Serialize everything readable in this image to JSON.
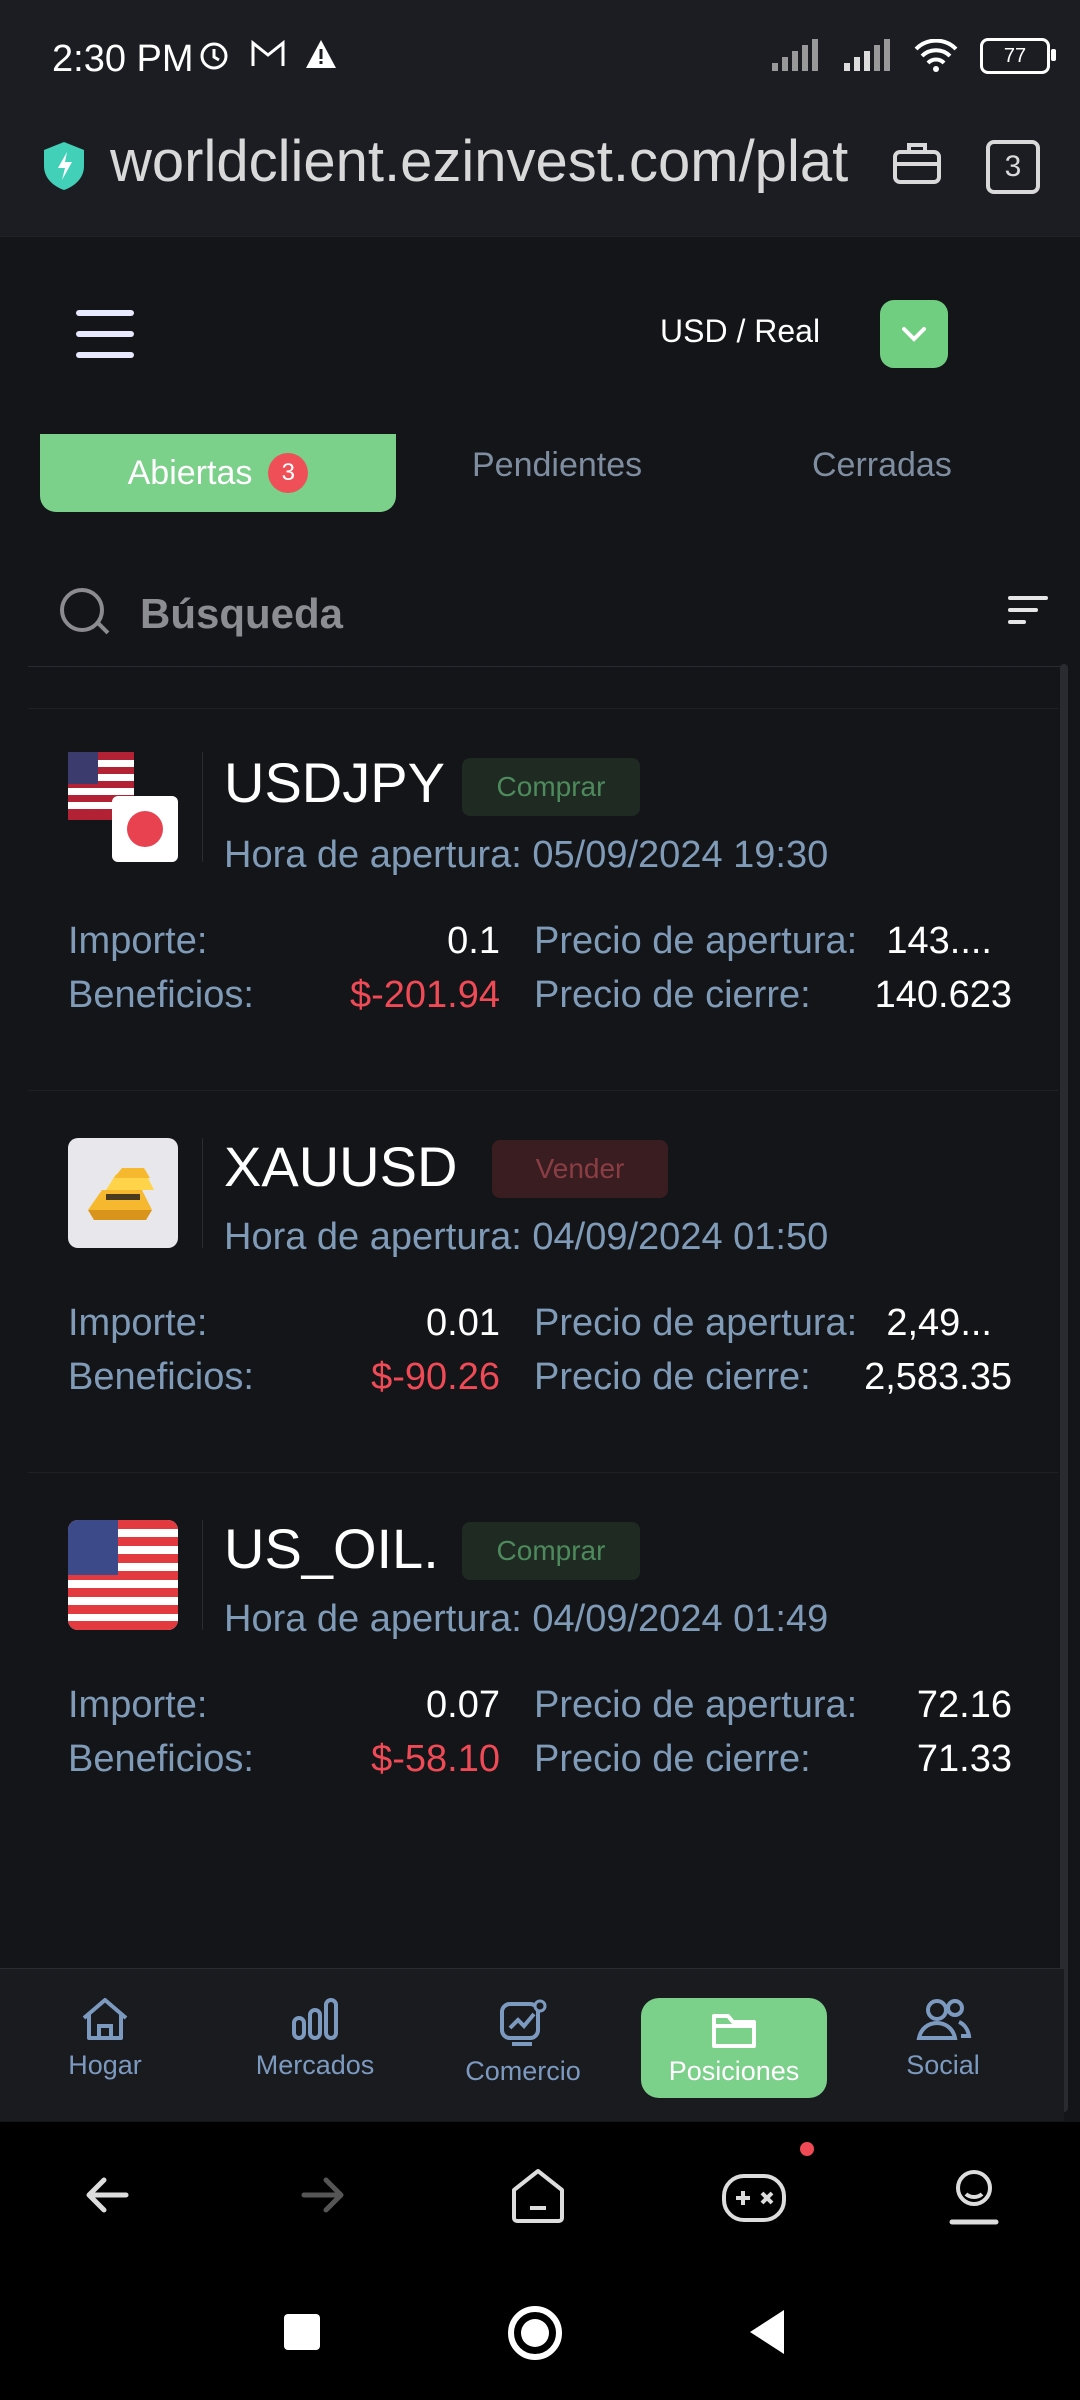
{
  "status_bar": {
    "time": "2:30 PM",
    "battery": "77"
  },
  "browser": {
    "url": "worldclient.ezinvest.com/plat",
    "tab_count": "3"
  },
  "header": {
    "account": "USD / Real"
  },
  "tabs": [
    {
      "label": "Abiertas",
      "badge": "3"
    },
    {
      "label": "Pendientes"
    },
    {
      "label": "Cerradas"
    }
  ],
  "search": {
    "placeholder": "Búsqueda"
  },
  "positions": [
    {
      "symbol": "USDJPY",
      "side": "Comprar",
      "open_time": "Hora de apertura: 05/09/2024 19:30",
      "amount_label": "Importe:",
      "amount": "0.1",
      "profit_label": "Beneficios:",
      "profit": "$-201.94",
      "open_price_label": "Precio de apertura:",
      "open_price": "143....",
      "close_price_label": "Precio de cierre:",
      "close_price": "140.623"
    },
    {
      "symbol": "XAUUSD",
      "side": "Vender",
      "open_time": "Hora de apertura: 04/09/2024 01:50",
      "amount_label": "Importe:",
      "amount": "0.01",
      "profit_label": "Beneficios:",
      "profit": "$-90.26",
      "open_price_label": "Precio de apertura:",
      "open_price": "2,49...",
      "close_price_label": "Precio de cierre:",
      "close_price": "2,583.35"
    },
    {
      "symbol": "US_OIL.",
      "side": "Comprar",
      "open_time": "Hora de apertura: 04/09/2024 01:49",
      "amount_label": "Importe:",
      "amount": "0.07",
      "profit_label": "Beneficios:",
      "profit": "$-58.10",
      "open_price_label": "Precio de apertura:",
      "open_price": "72.16",
      "close_price_label": "Precio de cierre:",
      "close_price": "71.33"
    }
  ],
  "bottom_nav": [
    {
      "label": "Hogar",
      "icon": "home-icon"
    },
    {
      "label": "Mercados",
      "icon": "markets-icon"
    },
    {
      "label": "Comercio",
      "icon": "trade-icon"
    },
    {
      "label": "Posiciones",
      "icon": "folder-icon",
      "active": true
    },
    {
      "label": "Social",
      "icon": "social-icon"
    }
  ],
  "colors": {
    "accent": "#7bd08a",
    "negative": "#ef4a55",
    "label": "#7f9bb8"
  }
}
